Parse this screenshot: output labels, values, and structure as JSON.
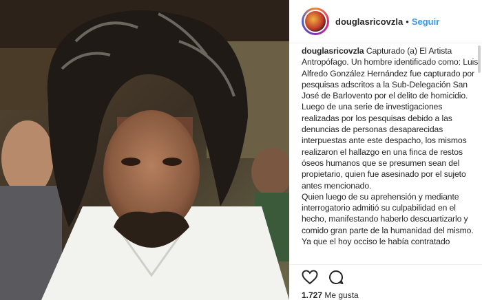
{
  "post": {
    "username": "douglasricovzla",
    "separator": "•",
    "follow_label": "Seguir",
    "caption_lines": [
      "Capturado (a) El Artista Antropófago. Un hombre identificado como: Luis Alfredo González Hernández fue capturado por pesquisas adscritos a la Sub-Delegación San José de Barlovento por el delito de homicidio.",
      "Luego de una serie de investigaciones realizadas por los pesquisas debido a las denuncias de personas desaparecidas interpuestas ante este despacho, los mismos realizaron el hallazgo en una finca de restos óseos humanos que se presumen sean del propietario, quien fue asesinado por el sujeto antes mencionado.",
      "Quien luego de su aprehensión y mediante interrogatorio admitió su culpabilidad en el hecho, manifestando haberlo descuartizarlo y comido gran parte de la humanidad del mismo.",
      "Ya que el hoy occiso le había contratado"
    ],
    "likes_count": "1.727",
    "likes_label": "Me gusta"
  },
  "icons": {
    "avatar": "avatar-icon",
    "like": "heart-icon",
    "comment": "comment-icon"
  },
  "colors": {
    "link": "#3897f0",
    "text": "#262626"
  }
}
